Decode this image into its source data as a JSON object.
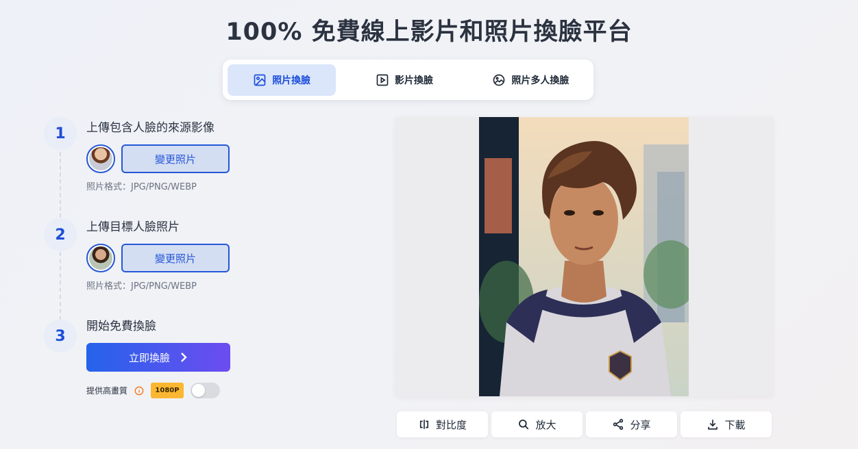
{
  "title": "100% 免費線上影片和照片換臉平台",
  "tabs": [
    {
      "label": "照片換臉",
      "icon": "image-icon",
      "active": true
    },
    {
      "label": "影片換臉",
      "icon": "play-icon",
      "active": false
    },
    {
      "label": "照片多人換臉",
      "icon": "image-multi-icon",
      "active": false
    }
  ],
  "steps": [
    {
      "number": "1",
      "title": "上傳包含人臉的來源影像",
      "button": "變更照片",
      "note": "照片格式：JPG/PNG/WEBP"
    },
    {
      "number": "2",
      "title": "上傳目標人臉照片",
      "button": "變更照片",
      "note": "照片格式：JPG/PNG/WEBP"
    },
    {
      "number": "3",
      "title": "開始免費換臉"
    }
  ],
  "swap_button": {
    "label": "立即換臉",
    "icon": "chevron-right-icon"
  },
  "hq": {
    "label": "提供高畫質",
    "badge": "1080P",
    "enabled": false
  },
  "actions": [
    {
      "label": "對比度",
      "icon": "compare-icon"
    },
    {
      "label": "放大",
      "icon": "search-icon"
    },
    {
      "label": "分享",
      "icon": "share-icon"
    },
    {
      "label": "下載",
      "icon": "download-icon"
    }
  ],
  "colors": {
    "accent": "#2557d6",
    "badge": "#fbb731",
    "gradient_start": "#2563eb",
    "gradient_end": "#6d4cf0"
  }
}
